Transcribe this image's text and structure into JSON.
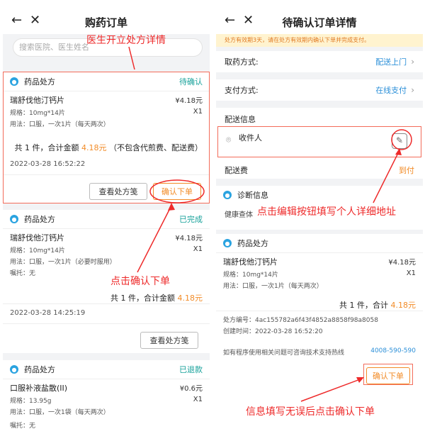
{
  "left": {
    "title": "购药订单",
    "search_placeholder": "搜索医院、医生姓名",
    "annotations": {
      "top": "医生开立处方详情",
      "mid": "点击确认下单"
    },
    "orders": [
      {
        "type": "药品处方",
        "status": "待确认",
        "drug": "瑞舒伐他汀钙片",
        "price": "¥4.18元",
        "spec": "规格：10mg*14片",
        "qty": "X1",
        "usage": "用法：口服，一次1片（每天两次）",
        "summary_pre": "共 1 件，合计金额",
        "amount": "4.18元",
        "summary_post": "（不包含代煎费、配送费）",
        "date": "2022-03-28 16:52:22",
        "btn_view": "查看处方笺",
        "btn_confirm": "确认下单"
      },
      {
        "type": "药品处方",
        "status": "已完成",
        "drug": "瑞舒伐他汀钙片",
        "price": "¥4.18元",
        "spec": "规格：10mg*14片",
        "qty": "X1",
        "usage": "用法：口服，一次1片（必要时服用）",
        "note": "嘱托：无",
        "summary_pre": "共 1 件，合计金额",
        "amount": "4.18元",
        "date": "2022-03-28 14:25:19",
        "btn_view": "查看处方笺"
      },
      {
        "type": "药品处方",
        "status": "已退款",
        "drug": "口服补液盐散(II)",
        "price": "¥0.6元",
        "spec": "规格：13.95g",
        "qty": "X1",
        "usage": "用法：口服，一次1袋（每天两次）",
        "note": "嘱托：无"
      }
    ]
  },
  "right": {
    "title": "待确认订单详情",
    "notice": "处方有效期3天，请在处方有效期内确认下单并完成支付。",
    "pickup_label": "取药方式:",
    "pickup_value": "配送上门",
    "pay_label": "支付方式:",
    "pay_value": "在线支付",
    "delivery_info": "配送信息",
    "receiver": "收件人",
    "fee_label": "配送费",
    "fee_value": "到付",
    "diag_title": "诊断信息",
    "diag_value": "健康查体",
    "rx_title": "药品处方",
    "drug": "瑞舒伐他汀钙片",
    "price": "¥4.18元",
    "spec": "规格：10mg*14片",
    "qty": "X1",
    "usage": "用法：口服，一次1片（每天两次）",
    "summary_pre": "共 1 件，合计",
    "amount": "4.18元",
    "rx_no": "处方编号：4ac155782a6f43f4852a8858f98a8058",
    "created": "创建时间：2022-03-28 16:52:20",
    "hotline_text": "如有程序使用相关问题可咨询技术支持热线",
    "hotline": "4008-590-590",
    "btn_confirm": "确认下单",
    "annotations": {
      "edit": "点击编辑按钮填写个人详细地址",
      "bottom": "信息填写无误后点击确认下单"
    }
  },
  "colors": {
    "accent_orange": "#f28c28",
    "status_teal": "#18a29b",
    "link_blue": "#2b8fd8",
    "annotation_red": "#ee2a2a"
  }
}
